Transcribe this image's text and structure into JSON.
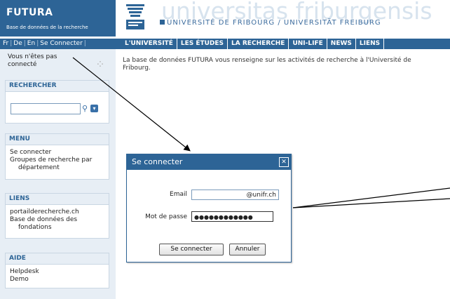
{
  "header": {
    "brand_title": "FUTURA",
    "brand_subtitle": "Base de données de la recherche",
    "watermark": "universitas friburgensis",
    "university_name": "UNIVERSITÉ DE FRIBOURG / UNIVERSITÄT FREIBURG"
  },
  "langbar": {
    "items": [
      "Fr",
      "De",
      "En",
      "Se Connecter"
    ],
    "separator": "|"
  },
  "nav": {
    "items": [
      "L'UNIVERSITÉ",
      "LES ÉTUDES",
      "LA RECHERCHE",
      "UNI-LIFE",
      "NEWS",
      "LIENS"
    ]
  },
  "sidebar": {
    "status": "Vous n'êtes pas connecté",
    "search_title": "RECHERCHER",
    "search_value": "",
    "menu_title": "MENU",
    "menu_items": [
      "Se connecter",
      "Groupes de recherche par",
      "département"
    ],
    "links_title": "LIENS",
    "links_items": [
      "portailderecherche.ch",
      "Base de données des",
      "fondations"
    ],
    "help_title": "AIDE",
    "help_items": [
      "Helpdesk",
      "Demo"
    ]
  },
  "main": {
    "intro": "La base de données FUTURA vous renseigne sur les activités de recherche à l'Université de Fribourg."
  },
  "dialog": {
    "title": "Se connecter",
    "close_glyph": "✕",
    "email_label": "Email",
    "email_value": "@unifr.ch",
    "password_label": "Mot de passe",
    "password_value": "●●●●●●●●●●●●",
    "submit_label": "Se connecter",
    "cancel_label": "Annuler"
  },
  "colors": {
    "primary": "#2d6496",
    "sidebar_bg": "#e7eef5",
    "watermark": "#d7e3ee"
  }
}
